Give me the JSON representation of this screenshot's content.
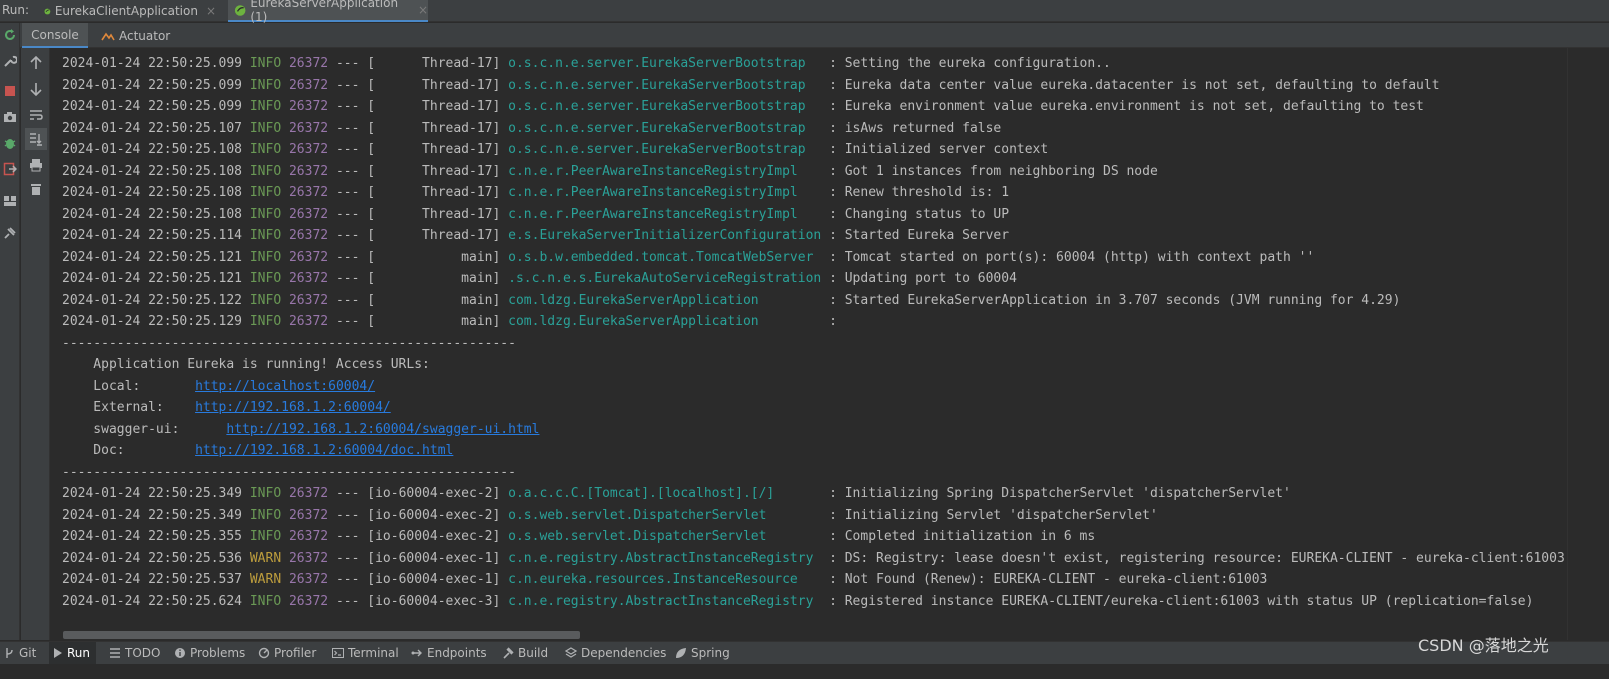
{
  "run_bar": {
    "label": "Run:",
    "tabs": [
      {
        "label": "EurekaClientApplication",
        "close": "×"
      },
      {
        "label": "EurekaServerApplication (1)",
        "close": "×"
      }
    ]
  },
  "sub_tabs": {
    "console": "Console",
    "actuator": "Actuator"
  },
  "logs_top": [
    {
      "ts": "2024-01-24 22:50:25.099",
      "level": "INFO",
      "pid": "26372",
      "sep": " --- ",
      "thread": "[      Thread-17] ",
      "logger": "o.s.c.n.e.server.EurekaServerBootstrap   ",
      "msg": ": Setting the eureka configuration.."
    },
    {
      "ts": "2024-01-24 22:50:25.099",
      "level": "INFO",
      "pid": "26372",
      "sep": " --- ",
      "thread": "[      Thread-17] ",
      "logger": "o.s.c.n.e.server.EurekaServerBootstrap   ",
      "msg": ": Eureka data center value eureka.datacenter is not set, defaulting to default"
    },
    {
      "ts": "2024-01-24 22:50:25.099",
      "level": "INFO",
      "pid": "26372",
      "sep": " --- ",
      "thread": "[      Thread-17] ",
      "logger": "o.s.c.n.e.server.EurekaServerBootstrap   ",
      "msg": ": Eureka environment value eureka.environment is not set, defaulting to test"
    },
    {
      "ts": "2024-01-24 22:50:25.107",
      "level": "INFO",
      "pid": "26372",
      "sep": " --- ",
      "thread": "[      Thread-17] ",
      "logger": "o.s.c.n.e.server.EurekaServerBootstrap   ",
      "msg": ": isAws returned false"
    },
    {
      "ts": "2024-01-24 22:50:25.108",
      "level": "INFO",
      "pid": "26372",
      "sep": " --- ",
      "thread": "[      Thread-17] ",
      "logger": "o.s.c.n.e.server.EurekaServerBootstrap   ",
      "msg": ": Initialized server context"
    },
    {
      "ts": "2024-01-24 22:50:25.108",
      "level": "INFO",
      "pid": "26372",
      "sep": " --- ",
      "thread": "[      Thread-17] ",
      "logger": "c.n.e.r.PeerAwareInstanceRegistryImpl    ",
      "msg": ": Got 1 instances from neighboring DS node"
    },
    {
      "ts": "2024-01-24 22:50:25.108",
      "level": "INFO",
      "pid": "26372",
      "sep": " --- ",
      "thread": "[      Thread-17] ",
      "logger": "c.n.e.r.PeerAwareInstanceRegistryImpl    ",
      "msg": ": Renew threshold is: 1"
    },
    {
      "ts": "2024-01-24 22:50:25.108",
      "level": "INFO",
      "pid": "26372",
      "sep": " --- ",
      "thread": "[      Thread-17] ",
      "logger": "c.n.e.r.PeerAwareInstanceRegistryImpl    ",
      "msg": ": Changing status to UP"
    },
    {
      "ts": "2024-01-24 22:50:25.114",
      "level": "INFO",
      "pid": "26372",
      "sep": " --- ",
      "thread": "[      Thread-17] ",
      "logger": "e.s.EurekaServerInitializerConfiguration ",
      "msg": ": Started Eureka Server"
    },
    {
      "ts": "2024-01-24 22:50:25.121",
      "level": "INFO",
      "pid": "26372",
      "sep": " --- ",
      "thread": "[           main] ",
      "logger": "o.s.b.w.embedded.tomcat.TomcatWebServer  ",
      "msg": ": Tomcat started on port(s): 60004 (http) with context path ''"
    },
    {
      "ts": "2024-01-24 22:50:25.121",
      "level": "INFO",
      "pid": "26372",
      "sep": " --- ",
      "thread": "[           main] ",
      "logger": ".s.c.n.e.s.EurekaAutoServiceRegistration ",
      "msg": ": Updating port to 60004"
    },
    {
      "ts": "2024-01-24 22:50:25.122",
      "level": "INFO",
      "pid": "26372",
      "sep": " --- ",
      "thread": "[           main] ",
      "logger": "com.ldzg.EurekaServerApplication         ",
      "msg": ": Started EurekaServerApplication in 3.707 seconds (JVM running for 4.29)"
    },
    {
      "ts": "2024-01-24 22:50:25.129",
      "level": "INFO",
      "pid": "26372",
      "sep": " --- ",
      "thread": "[           main] ",
      "logger": "com.ldzg.EurekaServerApplication         ",
      "msg": ":"
    }
  ],
  "banner": {
    "divider": "----------------------------------------------------------",
    "heading": "    Application Eureka is running! Access URLs:",
    "local_label": "    Local:       ",
    "local_url": "http://localhost:60004/",
    "external_label": "    External:    ",
    "external_url": "http://192.168.1.2:60004/",
    "swagger_label": "    swagger-ui:      ",
    "swagger_url": "http://192.168.1.2:60004/swagger-ui.html",
    "doc_label": "    Doc:         ",
    "doc_url": "http://192.168.1.2:60004/doc.html"
  },
  "logs_bottom": [
    {
      "ts": "2024-01-24 22:50:25.349",
      "level": "INFO",
      "pid": "26372",
      "sep": " --- ",
      "thread": "[io-60004-exec-2] ",
      "logger": "o.a.c.c.C.[Tomcat].[localhost].[/]       ",
      "msg": ": Initializing Spring DispatcherServlet 'dispatcherServlet'"
    },
    {
      "ts": "2024-01-24 22:50:25.349",
      "level": "INFO",
      "pid": "26372",
      "sep": " --- ",
      "thread": "[io-60004-exec-2] ",
      "logger": "o.s.web.servlet.DispatcherServlet        ",
      "msg": ": Initializing Servlet 'dispatcherServlet'"
    },
    {
      "ts": "2024-01-24 22:50:25.355",
      "level": "INFO",
      "pid": "26372",
      "sep": " --- ",
      "thread": "[io-60004-exec-2] ",
      "logger": "o.s.web.servlet.DispatcherServlet        ",
      "msg": ": Completed initialization in 6 ms"
    },
    {
      "ts": "2024-01-24 22:50:25.536",
      "level": "WARN",
      "pid": "26372",
      "sep": " --- ",
      "thread": "[io-60004-exec-1] ",
      "logger": "c.n.e.registry.AbstractInstanceRegistry  ",
      "msg": ": DS: Registry: lease doesn't exist, registering resource: EUREKA-CLIENT - eureka-client:61003"
    },
    {
      "ts": "2024-01-24 22:50:25.537",
      "level": "WARN",
      "pid": "26372",
      "sep": " --- ",
      "thread": "[io-60004-exec-1] ",
      "logger": "c.n.eureka.resources.InstanceResource    ",
      "msg": ": Not Found (Renew): EUREKA-CLIENT - eureka-client:61003"
    },
    {
      "ts": "2024-01-24 22:50:25.624",
      "level": "INFO",
      "pid": "26372",
      "sep": " --- ",
      "thread": "[io-60004-exec-3] ",
      "logger": "c.n.e.registry.AbstractInstanceRegistry  ",
      "msg": ": Registered instance EUREKA-CLIENT/eureka-client:61003 with status UP (replication=false)"
    }
  ],
  "status_bar": {
    "git": "Git",
    "run": "Run",
    "todo": "TODO",
    "problems": "Problems",
    "profiler": "Profiler",
    "terminal": "Terminal",
    "endpoints": "Endpoints",
    "build": "Build",
    "dependencies": "Dependencies",
    "spring": "Spring"
  },
  "watermark": "CSDN @落地之光",
  "colors": {
    "info": "#6a9955",
    "warn": "#bd9d3d",
    "pid": "#9876aa",
    "logger": "#2aa198",
    "link": "#287bde",
    "accent": "#4a88c7"
  }
}
